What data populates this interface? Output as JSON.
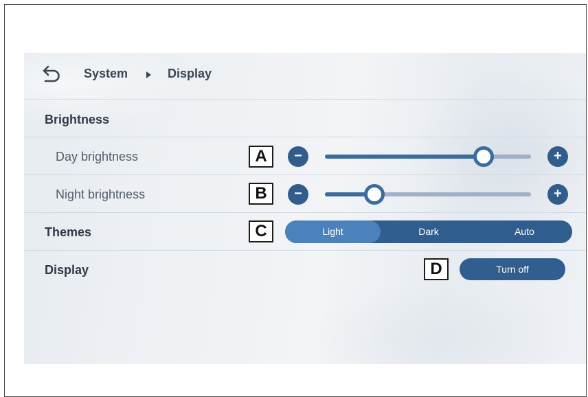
{
  "breadcrumb": {
    "parent": "System",
    "current": "Display"
  },
  "icons": {
    "back": "back-arrow-icon",
    "separator": "triangle-right-icon",
    "decrease": "minus-icon",
    "increase": "plus-icon"
  },
  "sections": {
    "brightness": {
      "title": "Brightness",
      "day": {
        "label": "Day brightness",
        "marker": "A",
        "level": 0.77,
        "decrease_symbol": "−",
        "increase_symbol": "+"
      },
      "night": {
        "label": "Night brightness",
        "marker": "B",
        "level": 0.24,
        "decrease_symbol": "−",
        "increase_symbol": "+"
      }
    },
    "themes": {
      "title": "Themes",
      "marker": "C",
      "options": [
        "Light",
        "Dark",
        "Auto"
      ],
      "selected": "Light"
    },
    "display": {
      "title": "Display",
      "marker": "D",
      "button_label": "Turn off"
    }
  },
  "colors": {
    "accent": "#315d8d",
    "accent_light": "#4c82bb",
    "track": "#9fb1c6",
    "text": "#3b4654"
  }
}
